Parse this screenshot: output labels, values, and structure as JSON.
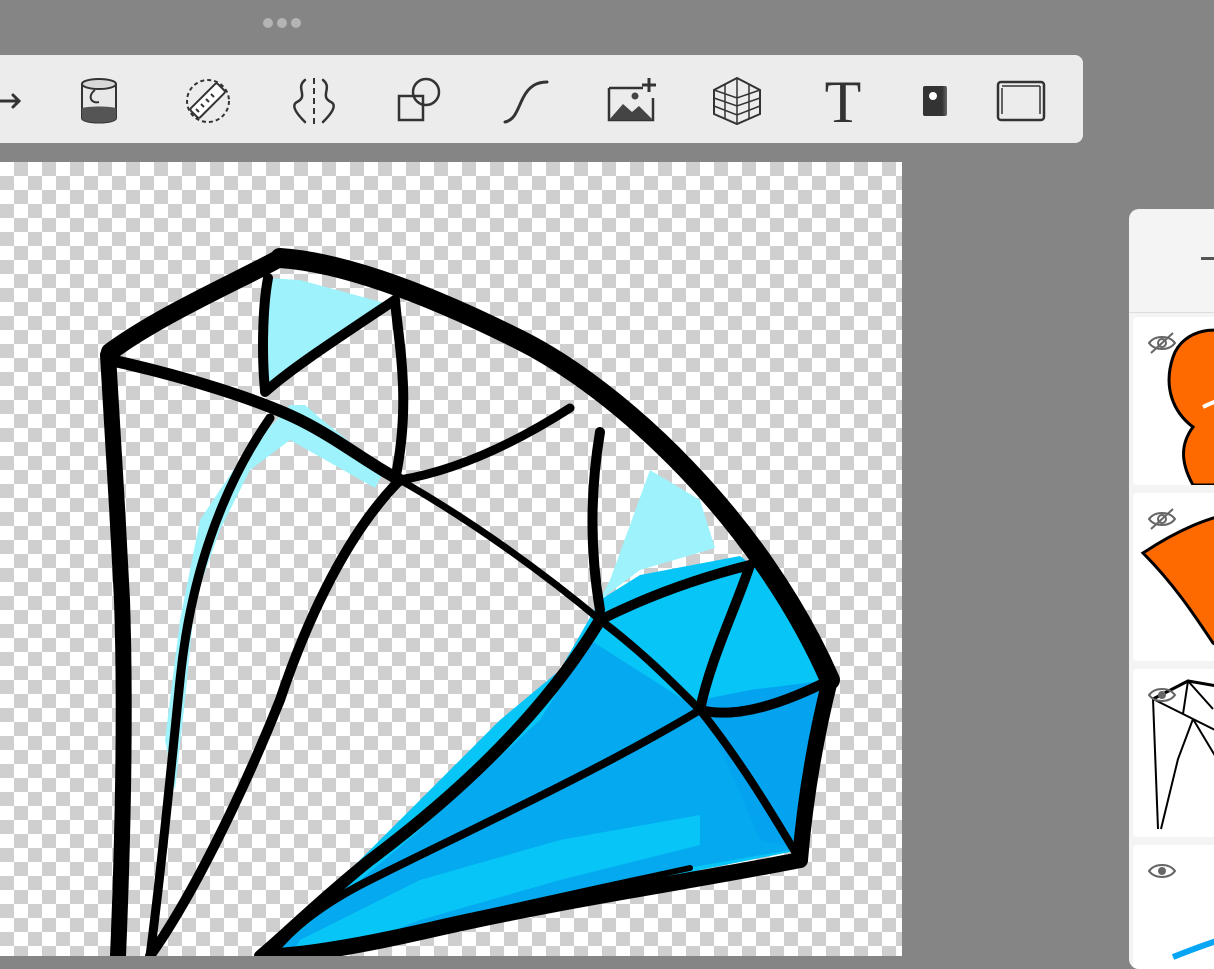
{
  "app": {
    "more_icon": "ellipsis-icon",
    "accent": "#ececec",
    "canvas_background": "transparent-checkerboard"
  },
  "toolbar": {
    "tools": [
      {
        "icon": "arrow-right-icon"
      },
      {
        "icon": "paint-bucket-icon"
      },
      {
        "icon": "ruler-icon"
      },
      {
        "icon": "symmetry-icon"
      },
      {
        "icon": "shapes-icon"
      },
      {
        "icon": "curve-icon"
      },
      {
        "icon": "add-image-icon"
      },
      {
        "icon": "perspective-grid-icon"
      },
      {
        "icon": "text-icon",
        "label": "T"
      },
      {
        "icon": "selection-icon"
      },
      {
        "icon": "frame-icon"
      }
    ]
  },
  "artwork": {
    "colors": {
      "outline": "#000000",
      "light_cyan": "#9ef2fb",
      "cyan": "#07c6f7",
      "blue": "#04a3ef"
    }
  },
  "layers_panel": {
    "collapse_icon": "minus-icon",
    "layers": [
      {
        "visible": false,
        "visibility_icon": "eye-hidden-icon",
        "thumbnail": "orange-character"
      },
      {
        "visible": false,
        "visibility_icon": "eye-hidden-icon",
        "thumbnail": "orange-shape"
      },
      {
        "visible": true,
        "visibility_icon": "eye-icon",
        "thumbnail": "diamond-line-art"
      },
      {
        "visible": true,
        "visibility_icon": "eye-icon",
        "thumbnail": "blue-strokes"
      }
    ]
  }
}
